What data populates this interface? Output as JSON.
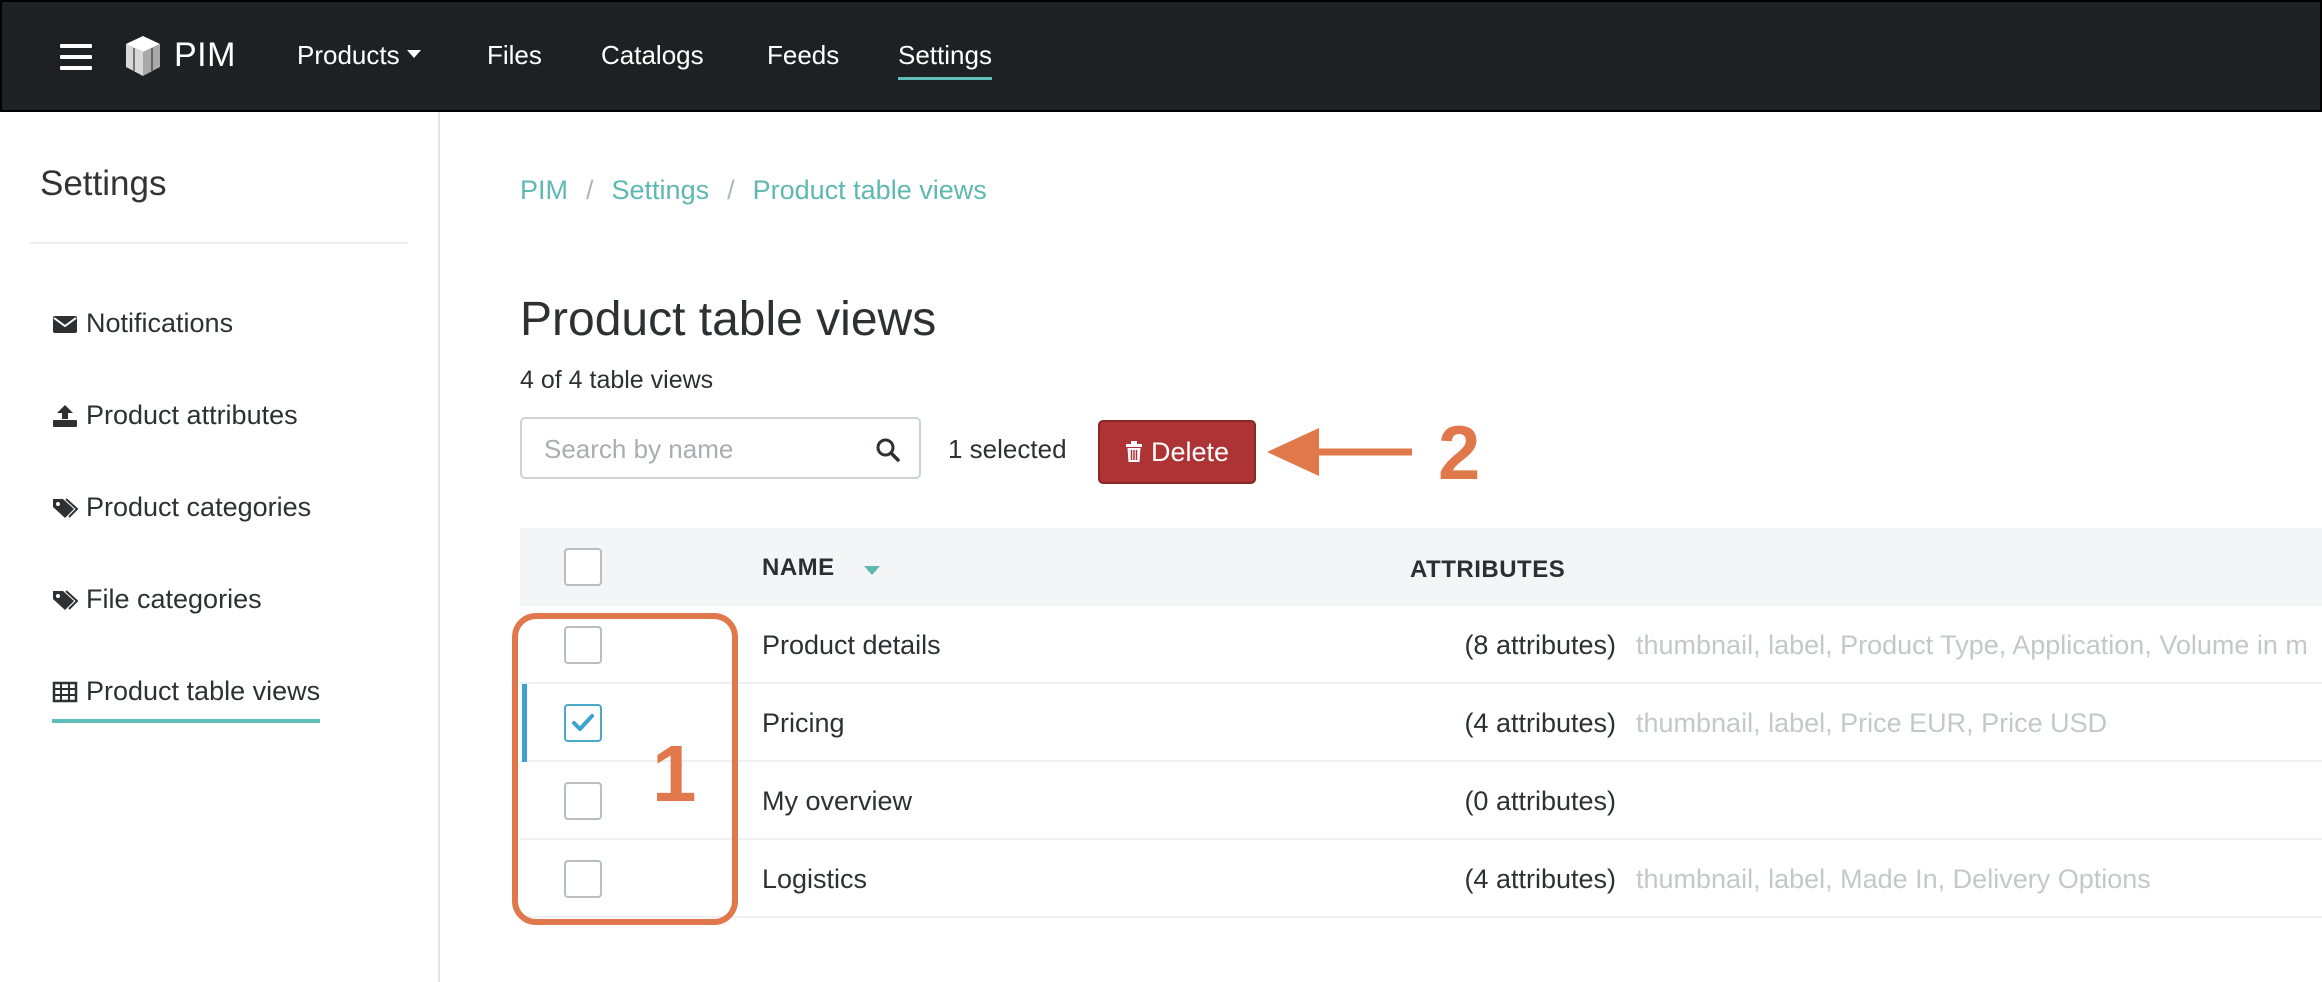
{
  "app": {
    "brand": "PIM"
  },
  "nav": {
    "items": [
      {
        "label": "Products",
        "has_caret": true
      },
      {
        "label": "Files"
      },
      {
        "label": "Catalogs"
      },
      {
        "label": "Feeds"
      },
      {
        "label": "Settings",
        "active": true
      }
    ]
  },
  "sidebar": {
    "title": "Settings",
    "items": [
      {
        "label": "Notifications",
        "icon": "envelope-icon"
      },
      {
        "label": "Product attributes",
        "icon": "upload-icon"
      },
      {
        "label": "Product categories",
        "icon": "tags-icon"
      },
      {
        "label": "File categories",
        "icon": "tags-icon"
      },
      {
        "label": "Product table views",
        "icon": "table-icon",
        "active": true
      }
    ]
  },
  "breadcrumb": [
    "PIM",
    "Settings",
    "Product table views"
  ],
  "breadcrumb_separator": "/",
  "page": {
    "title": "Product table views",
    "count_text": "4 of 4 table views"
  },
  "toolbar": {
    "search_placeholder": "Search by name",
    "selected_text": "1 selected",
    "delete_label": "Delete"
  },
  "table": {
    "headers": {
      "name": "NAME",
      "attributes": "ATTRIBUTES"
    },
    "rows": [
      {
        "name": "Product details",
        "attr_count": "(8 attributes)",
        "attr_list": "thumbnail, label, Product Type, Application, Volume in m",
        "checked": false
      },
      {
        "name": "Pricing",
        "attr_count": "(4 attributes)",
        "attr_list": "thumbnail, label, Price EUR, Price USD",
        "checked": true
      },
      {
        "name": "My overview",
        "attr_count": "(0 attributes)",
        "attr_list": "",
        "checked": false
      },
      {
        "name": "Logistics",
        "attr_count": "(4 attributes)",
        "attr_list": "thumbnail, label, Made In, Delivery Options",
        "checked": false
      }
    ]
  },
  "annotations": {
    "marker_1": "1",
    "marker_2": "2"
  },
  "colors": {
    "accent": "#5fb8b1",
    "danger": "#ad3335",
    "annotation": "#e0784b",
    "topbar": "#1e2124",
    "check": "#3aa3cf"
  }
}
